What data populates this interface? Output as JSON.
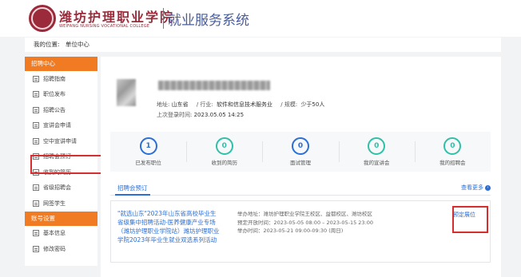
{
  "header": {
    "school_cn": "潍坊护理职业学院",
    "school_en": "WEIFANG NURSING VOCATIONAL COLLEGE",
    "system_title": "就业服务系统"
  },
  "breadcrumb": {
    "prefix": "我的位置:",
    "current": "单位中心"
  },
  "sidebar": {
    "group1": "招聘中心",
    "items1": [
      {
        "label": "招聘指南"
      },
      {
        "label": "职位发布"
      },
      {
        "label": "招聘公告"
      },
      {
        "label": "宣讲会申请"
      },
      {
        "label": "空中宣讲申请"
      },
      {
        "label": "招聘会预订"
      },
      {
        "label": "收到的简历"
      },
      {
        "label": "省级招聘会"
      },
      {
        "label": "网签学生"
      }
    ],
    "group2": "账号设置",
    "items2": [
      {
        "label": "基本信息"
      },
      {
        "label": "修改密码"
      }
    ]
  },
  "company": {
    "address_label": "地址:",
    "address": "山东省",
    "industry_label": "/ 行业:",
    "industry": "软件和信息技术服务业",
    "scale_label": "/ 规模:",
    "scale": "少于50人",
    "login_label": "上次登录时间:",
    "login_time": "2023.05.05 14:25"
  },
  "stats": [
    {
      "value": "1",
      "label": "已发布职位",
      "color": "#2b6fd6"
    },
    {
      "value": "0",
      "label": "收到的简历",
      "color": "#2fc0a8"
    },
    {
      "value": "0",
      "label": "面试管理",
      "color": "#2b6fd6"
    },
    {
      "value": "0",
      "label": "我的宣讲会",
      "color": "#2fc0a8"
    },
    {
      "value": "0",
      "label": "我的招聘会",
      "color": "#2fc0a8"
    }
  ],
  "tabs": {
    "active": "招聘会预订",
    "more": "查看更多"
  },
  "fair": {
    "title": "\"就选山东\"2023年山东省高校毕业生省级集中招聘活动-医养健康产业专场（潍坊护理职业学院站）潍坊护理职业学院2023年毕业生就业双选系列活动",
    "venue": "举办地址：潍坊护理职业学院王校区、益都校区、潍坊校区",
    "booking": "预定开放时间：2023-05-05 08:00 – 2023-05-15 23:00",
    "held": "举办时间：2023-05-21 09:00-09:30 (周日)",
    "action": "预定展位"
  },
  "colors": {
    "accent_orange": "#f07b23",
    "link_blue": "#2b6fd6",
    "teal": "#2fc0a8",
    "highlight_red": "#d62e2e",
    "brand": "#9b2a3a"
  }
}
